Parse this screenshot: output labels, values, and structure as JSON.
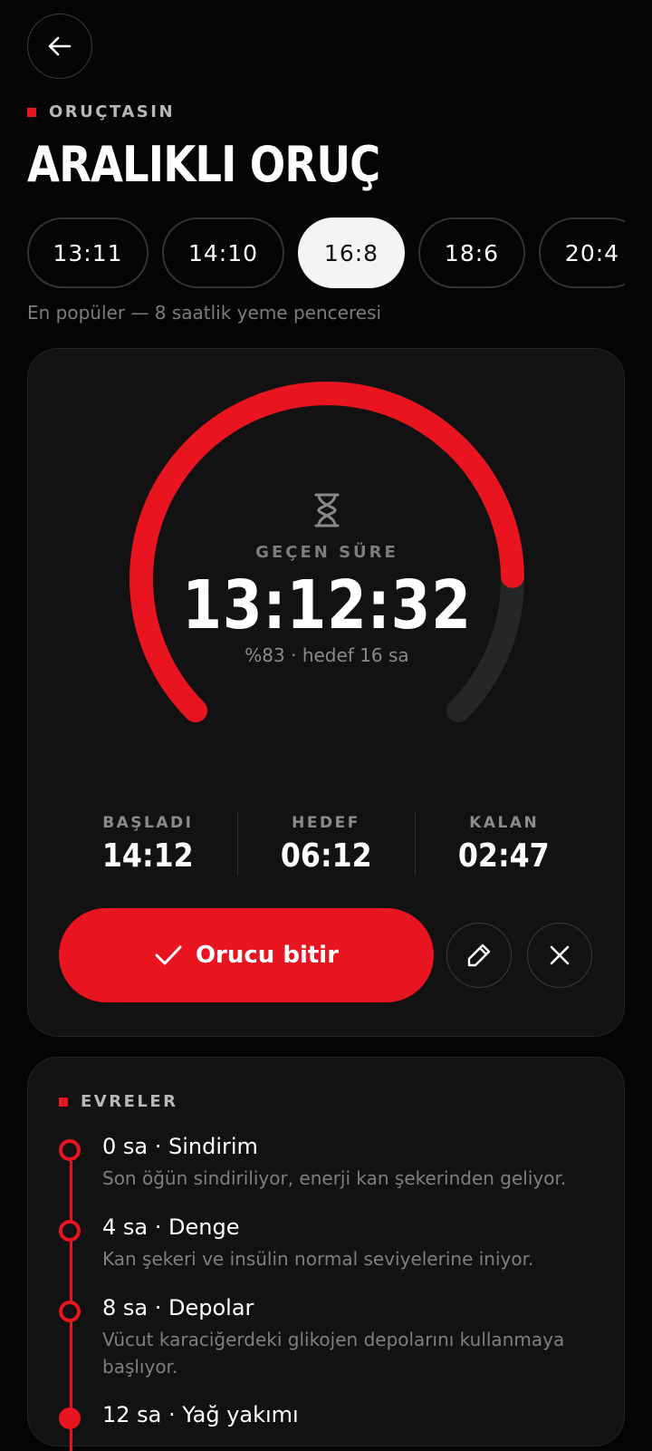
{
  "header": {
    "brand": "ORUÇTASIN",
    "title": "ARALIKLI ORUÇ",
    "back_icon": "arrow-left-icon"
  },
  "plans": {
    "items": [
      {
        "label": "13:11",
        "active": false
      },
      {
        "label": "14:10",
        "active": false
      },
      {
        "label": "16:8",
        "active": true
      },
      {
        "label": "18:6",
        "active": false
      },
      {
        "label": "20:4",
        "active": false
      }
    ],
    "description": "En popüler — 8 saatlik yeme penceresi"
  },
  "timer": {
    "label": "GEÇEN SÜRE",
    "elapsed": "13:12:32",
    "progress_text": "%83 · hedef 16 sa",
    "progress_fraction": 0.83,
    "accent_color": "#e8141f",
    "track_color": "#262626",
    "icon": "hourglass-icon"
  },
  "stats": [
    {
      "label": "BAŞLADI",
      "value": "14:12"
    },
    {
      "label": "HEDEF",
      "value": "06:12"
    },
    {
      "label": "KALAN",
      "value": "02:47"
    }
  ],
  "actions": {
    "end_label": "Orucu bitir",
    "end_icon": "check-icon",
    "edit_icon": "pencil-icon",
    "cancel_icon": "close-icon"
  },
  "phases": {
    "title": "EVRELER",
    "items": [
      {
        "title": "0 sa · Sindirim",
        "desc": "Son öğün sindiriliyor, enerji kan şekerinden geliyor."
      },
      {
        "title": "4 sa · Denge",
        "desc": "Kan şekeri ve insülin normal seviyelerine iniyor."
      },
      {
        "title": "8 sa · Depolar",
        "desc": "Vücut karaciğerdeki glikojen depolarını kullanmaya başlıyor."
      },
      {
        "title": "12 sa · Yağ yakımı",
        "desc": ""
      }
    ]
  }
}
